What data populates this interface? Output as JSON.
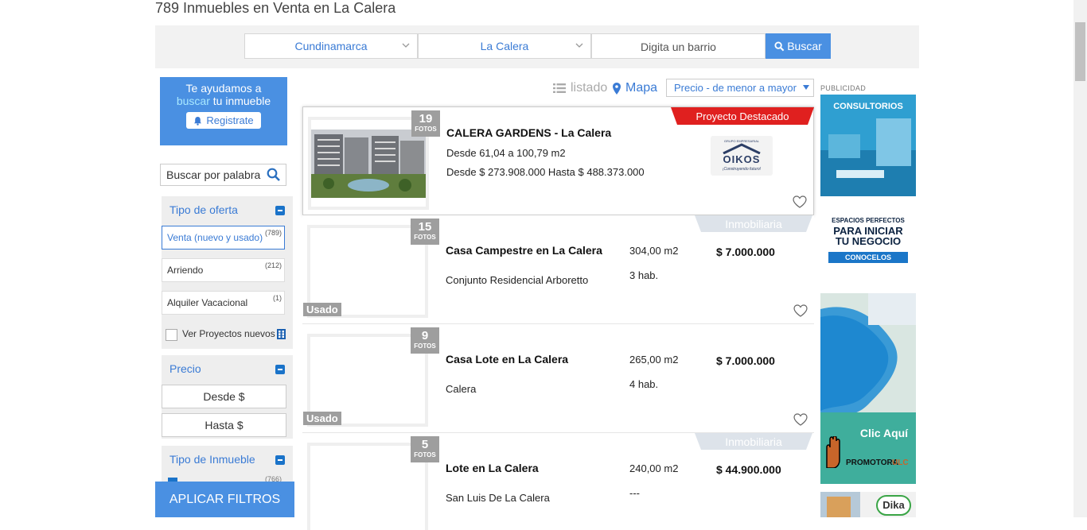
{
  "page_title": "789 Inmuebles en Venta en La Calera",
  "search": {
    "department": "Cundinamarca",
    "city": "La Calera",
    "neighborhood_placeholder": "Digita un barrio",
    "button": "Buscar"
  },
  "register": {
    "line1": "Te ayudamos a",
    "highlight": "buscar",
    "line2_rest": " tu inmueble",
    "button": "Registrate"
  },
  "keyword_placeholder": "Buscar por palabra",
  "filters": {
    "offer_title": "Tipo de oferta",
    "offers": [
      {
        "label": "Venta (nuevo y usado)",
        "count": "(789)"
      },
      {
        "label": "Arriendo",
        "count": "(212)"
      },
      {
        "label": "Alquiler Vacacional",
        "count": "(1)"
      }
    ],
    "new_projects": "Ver Proyectos nuevos",
    "price_title": "Precio",
    "price_from": "Desde $",
    "price_to": "Hasta $",
    "type_title": "Tipo de Inmueble",
    "type_count": "(766)"
  },
  "apply_button": "APLICAR FILTROS",
  "view": {
    "list": "listado",
    "map": "Mapa"
  },
  "sort": "Precio - de menor a mayor",
  "listings": [
    {
      "photos": "19",
      "fotos_label": "FOTOS",
      "title": "CALERA GARDENS - La Calera",
      "line1": "Desde 61,04 a 100,79 m2",
      "line2": "Desde $ 273.908.000 Hasta $ 488.373.000",
      "badge": "Proyecto Destacado",
      "logo_top": "GRUPO EMPRESARIAL",
      "logo_name": "OIKOS",
      "logo_tag": "¡Construyendo futuro!"
    },
    {
      "photos": "15",
      "fotos_label": "FOTOS",
      "title": "Casa Campestre en La Calera",
      "area": "304,00 m2",
      "price": "$ 7.000.000",
      "location": "Conjunto Residencial Arboretto",
      "rooms": "3 hab.",
      "condition": "Usado",
      "badge": "Inmobiliaria"
    },
    {
      "photos": "9",
      "fotos_label": "FOTOS",
      "title": "Casa Lote en La Calera",
      "area": "265,00 m2",
      "price": "$ 7.000.000",
      "location": "Calera",
      "rooms": "4 hab.",
      "condition": "Usado"
    },
    {
      "photos": "5",
      "fotos_label": "FOTOS",
      "title": "Lote en La Calera",
      "area": "240,00 m2",
      "price": "$ 44.900.000",
      "location": "San Luis De La Calera",
      "rooms": "---",
      "badge": "Inmobiliaria"
    }
  ],
  "ads": {
    "label": "PUBLICIDAD",
    "ad1_title": "CONSULTORIOS",
    "ad1_line1": "ESPACIOS PERFECTOS",
    "ad1_line2": "PARA INICIAR",
    "ad1_line3": "TU NEGOCIO",
    "ad1_cta": "CONOCELOS",
    "ad2_cta": "Clic Aquí",
    "ad2_brand": "PROMOTORA",
    "ad2_brand_suffix": "ULC",
    "ad3_brand": "Dika"
  },
  "colors": {
    "accent": "#4a90e2",
    "link": "#3a7bd5",
    "badge_red": "#e0201f",
    "badge_gray": "#dde3ea"
  }
}
